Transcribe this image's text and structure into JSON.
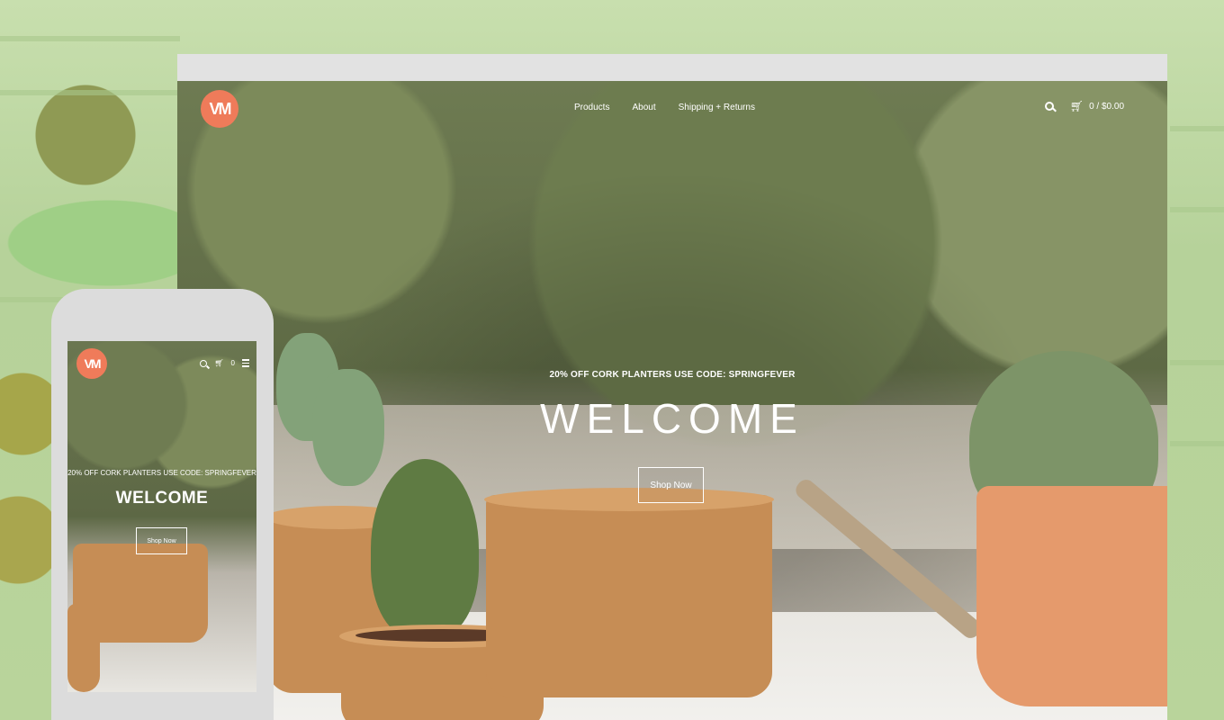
{
  "brand": {
    "logo_text": "VM",
    "accent": "#ef7b5a"
  },
  "desktop": {
    "nav": [
      {
        "label": "Products"
      },
      {
        "label": "About"
      },
      {
        "label": "Shipping + Returns"
      }
    ],
    "cart": {
      "label": "0 / $0.00"
    },
    "hero": {
      "promo": "20% OFF CORK PLANTERS USE CODE: SPRINGFEVER",
      "title": "WELCOME",
      "cta": "Shop Now"
    }
  },
  "mobile": {
    "cart_count": "0",
    "hero": {
      "promo": "20% OFF CORK PLANTERS USE CODE: SPRINGFEVER",
      "title": "WELCOME",
      "cta": "Shop Now"
    }
  },
  "icons": [
    "search-icon",
    "cart-icon",
    "menu-icon"
  ]
}
